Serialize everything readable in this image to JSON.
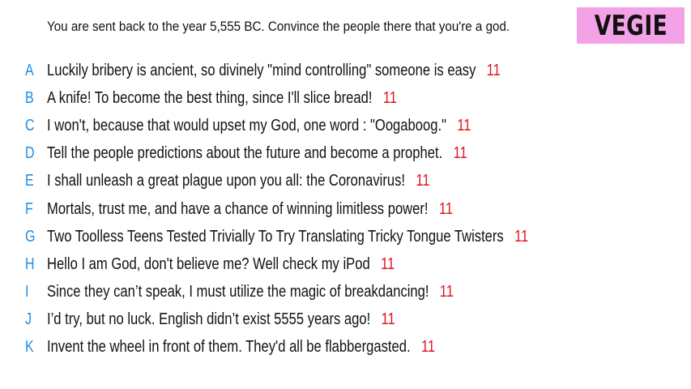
{
  "prompt": "You are sent back to the year 5,555 BC. Convince the people there that you're a god.",
  "player_tag": {
    "name": "VEGIE",
    "background_color": "#f4a2e8"
  },
  "colors": {
    "letter": "#1e8fe6",
    "score": "#e0161d"
  },
  "answers": [
    {
      "letter": "A",
      "text": "Luckily bribery is ancient, so divinely \"mind controlling\" someone is easy",
      "score": "11"
    },
    {
      "letter": "B",
      "text": "A knife! To become the best thing, since I'll slice bread!",
      "score": "11"
    },
    {
      "letter": "C",
      "text": "I won't, because that would upset my God, one word : \"Oogaboog.\"",
      "score": "11"
    },
    {
      "letter": "D",
      "text": "Tell the people predictions about the future and become a prophet.",
      "score": "11"
    },
    {
      "letter": "E",
      "text": "I shall unleash a great plague upon you all: the Coronavirus!",
      "score": "11"
    },
    {
      "letter": "F",
      "text": "Mortals, trust me, and have a chance of winning limitless power!",
      "score": "11"
    },
    {
      "letter": "G",
      "text": "Two Toolless Teens Tested Trivially To Try Translating Tricky Tongue Twisters",
      "score": "11"
    },
    {
      "letter": "H",
      "text": "Hello I am God, don't believe me? Well check my iPod",
      "score": "11"
    },
    {
      "letter": "I",
      "text": "Since they can’t speak, I must utilize the magic of breakdancing!",
      "score": "11"
    },
    {
      "letter": "J",
      "text": "I’d try, but no luck. English didn’t exist 5555 years ago!",
      "score": "11"
    },
    {
      "letter": "K",
      "text": "Invent the wheel in front of them. They'd all be flabbergasted.",
      "score": "11"
    }
  ]
}
